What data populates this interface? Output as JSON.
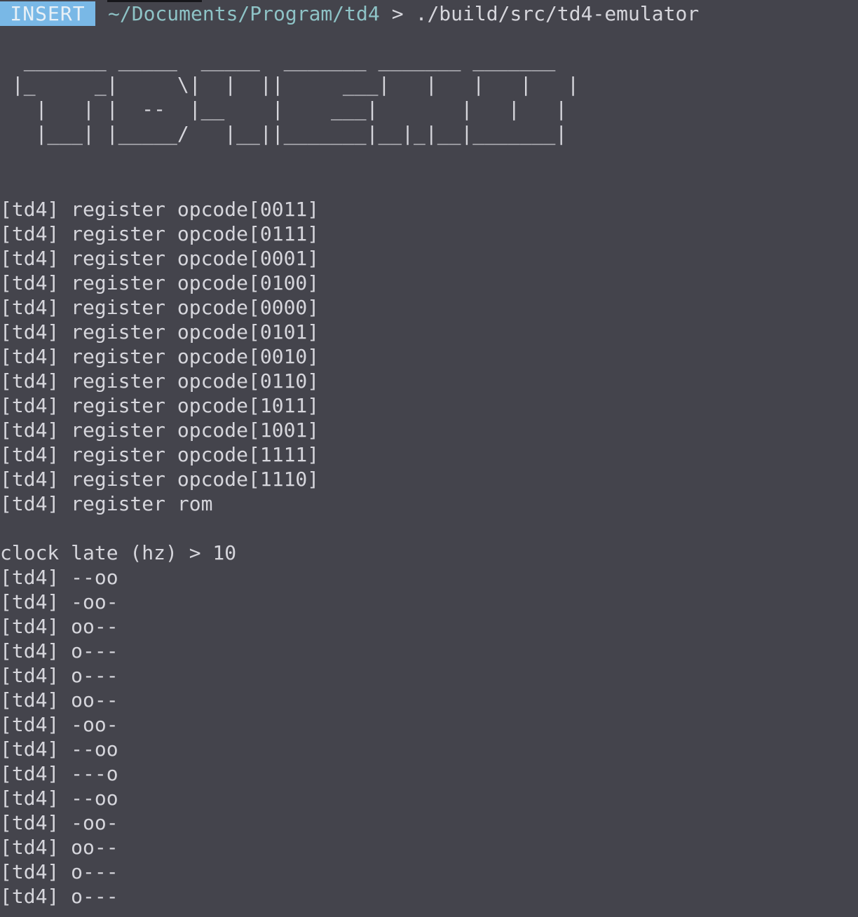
{
  "prompt": {
    "mode": "INSERT",
    "cwd": "~/Documents/Program/td4",
    "symbol": ">",
    "command": "./build/src/td4-emulator"
  },
  "banner_lines": [
    "  _______ _____  _____  _______ _______ _______",
    " |_     _|     \\|  |  ||     ___|   |   |   |   |",
    "   |   | |  --  |__    |    ___|       |   |   |",
    "   |___| |_____/   |__||_______|__|_|__|_______|"
  ],
  "register_lines": [
    "[td4] register opcode[0011]",
    "[td4] register opcode[0111]",
    "[td4] register opcode[0001]",
    "[td4] register opcode[0100]",
    "[td4] register opcode[0000]",
    "[td4] register opcode[0101]",
    "[td4] register opcode[0010]",
    "[td4] register opcode[0110]",
    "[td4] register opcode[1011]",
    "[td4] register opcode[1001]",
    "[td4] register opcode[1111]",
    "[td4] register opcode[1110]",
    "[td4] register rom"
  ],
  "clock_prompt": "clock late (hz) > 10",
  "led_lines": [
    "[td4] --oo",
    "[td4] -oo-",
    "[td4] oo--",
    "[td4] o---",
    "[td4] o---",
    "[td4] oo--",
    "[td4] -oo-",
    "[td4] --oo",
    "[td4] ---o",
    "[td4] --oo",
    "[td4] -oo-",
    "[td4] oo--",
    "[td4] o---",
    "[td4] o---"
  ],
  "colors": {
    "background": "#44444c",
    "foreground": "#d6d6dc",
    "mode_badge": "#79b8e6",
    "cwd": "#8ec3c6"
  }
}
